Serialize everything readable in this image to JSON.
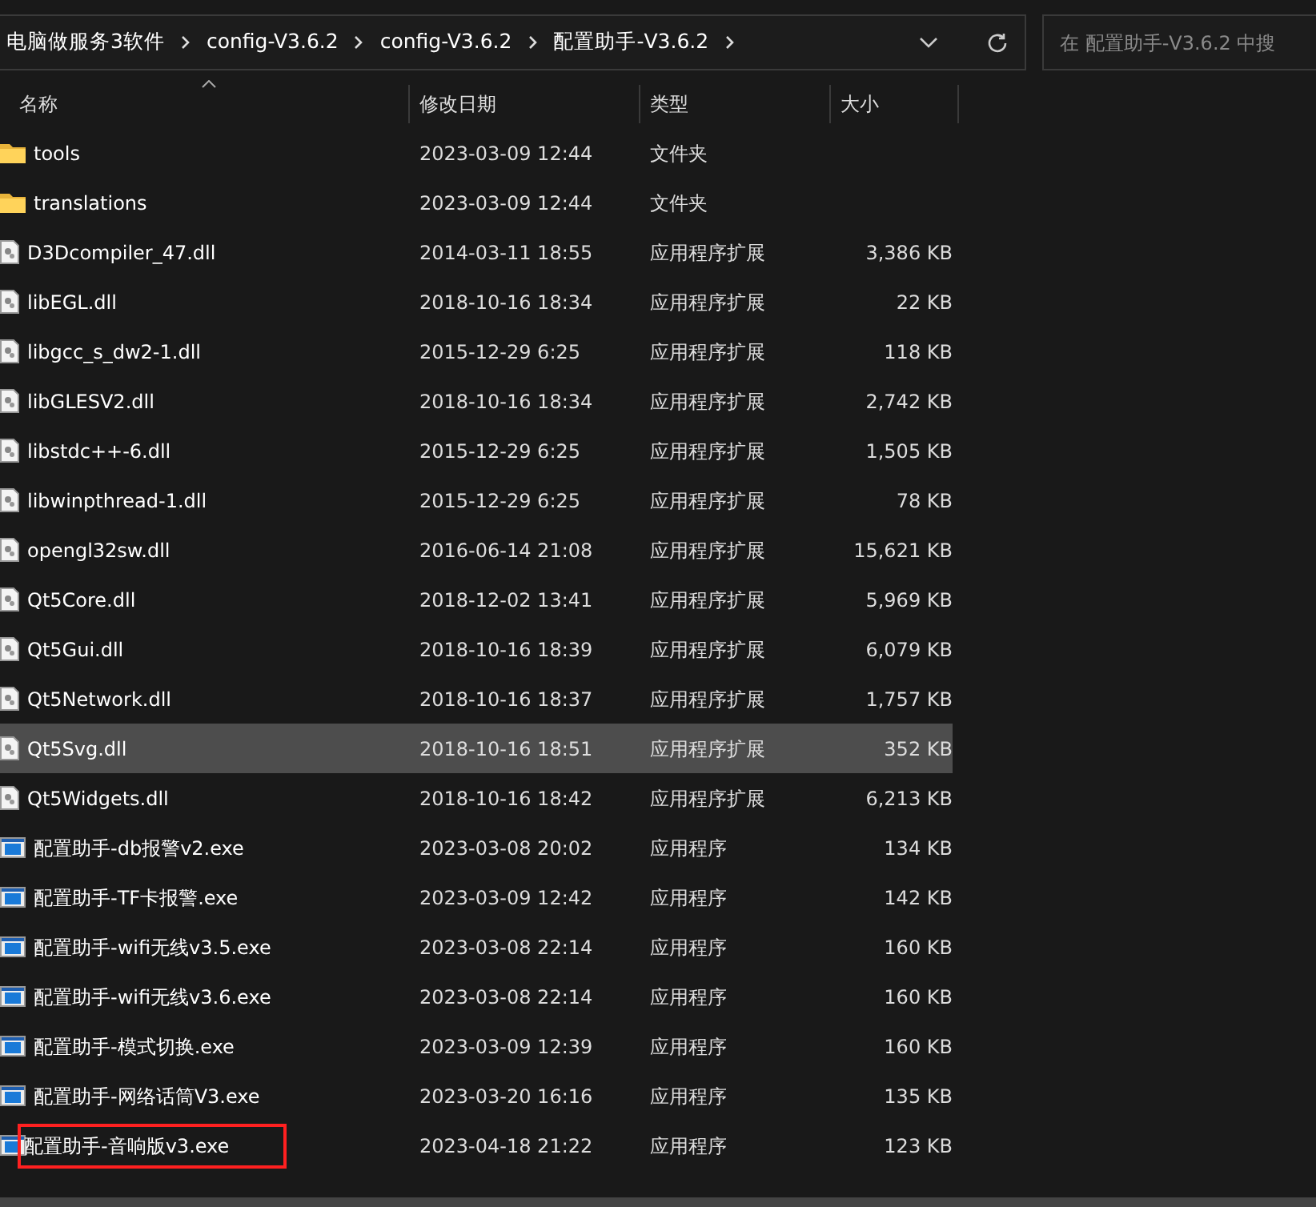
{
  "breadcrumb": [
    "电脑做服务3软件",
    "config-V3.6.2",
    "config-V3.6.2",
    "配置助手-V3.6.2"
  ],
  "search": {
    "placeholder": "在 配置助手-V3.6.2 中搜"
  },
  "columns": [
    "名称",
    "修改日期",
    "类型",
    "大小"
  ],
  "rows": [
    {
      "kind": "folder",
      "name": "tools",
      "date": "2023-03-09 12:44",
      "type": "文件夹",
      "selected": false
    },
    {
      "kind": "folder",
      "name": "translations",
      "date": "2023-03-09 12:44",
      "type": "文件夹",
      "selected": false
    },
    {
      "kind": "dll",
      "name": "D3Dcompiler_47.dll",
      "date": "2014-03-11 18:55",
      "type": "应用程序扩展",
      "size": "3,386 KB",
      "selected": false
    },
    {
      "kind": "dll",
      "name": "libEGL.dll",
      "date": "2018-10-16 18:34",
      "type": "应用程序扩展",
      "size": "22 KB",
      "selected": false
    },
    {
      "kind": "dll",
      "name": "libgcc_s_dw2-1.dll",
      "date": "2015-12-29 6:25",
      "type": "应用程序扩展",
      "size": "118 KB",
      "selected": false
    },
    {
      "kind": "dll",
      "name": "libGLESV2.dll",
      "date": "2018-10-16 18:34",
      "type": "应用程序扩展",
      "size": "2,742 KB",
      "selected": false
    },
    {
      "kind": "dll",
      "name": "libstdc++-6.dll",
      "date": "2015-12-29 6:25",
      "type": "应用程序扩展",
      "size": "1,505 KB",
      "selected": false
    },
    {
      "kind": "dll",
      "name": "libwinpthread-1.dll",
      "date": "2015-12-29 6:25",
      "type": "应用程序扩展",
      "size": "78 KB",
      "selected": false
    },
    {
      "kind": "dll",
      "name": "opengl32sw.dll",
      "date": "2016-06-14 21:08",
      "type": "应用程序扩展",
      "size": "15,621 KB",
      "selected": false
    },
    {
      "kind": "dll",
      "name": "Qt5Core.dll",
      "date": "2018-12-02 13:41",
      "type": "应用程序扩展",
      "size": "5,969 KB",
      "selected": false
    },
    {
      "kind": "dll",
      "name": "Qt5Gui.dll",
      "date": "2018-10-16 18:39",
      "type": "应用程序扩展",
      "size": "6,079 KB",
      "selected": false
    },
    {
      "kind": "dll",
      "name": "Qt5Network.dll",
      "date": "2018-10-16 18:37",
      "type": "应用程序扩展",
      "size": "1,757 KB",
      "selected": false
    },
    {
      "kind": "dll",
      "name": "Qt5Svg.dll",
      "date": "2018-10-16 18:51",
      "type": "应用程序扩展",
      "size": "352 KB",
      "selected": true
    },
    {
      "kind": "dll",
      "name": "Qt5Widgets.dll",
      "date": "2018-10-16 18:42",
      "type": "应用程序扩展",
      "size": "6,213 KB",
      "selected": false
    },
    {
      "kind": "exe",
      "name": "配置助手-db报警v2.exe",
      "date": "2023-03-08 20:02",
      "type": "应用程序",
      "size": "134 KB",
      "selected": false
    },
    {
      "kind": "exe",
      "name": "配置助手-TF卡报警.exe",
      "date": "2023-03-09 12:42",
      "type": "应用程序",
      "size": "142 KB",
      "selected": false
    },
    {
      "kind": "exe",
      "name": "配置助手-wifi无线v3.5.exe",
      "date": "2023-03-08 22:14",
      "type": "应用程序",
      "size": "160 KB",
      "selected": false
    },
    {
      "kind": "exe",
      "name": "配置助手-wifi无线v3.6.exe",
      "date": "2023-03-08 22:14",
      "type": "应用程序",
      "size": "160 KB",
      "selected": false
    },
    {
      "kind": "exe",
      "name": "配置助手-模式切换.exe",
      "date": "2023-03-09 12:39",
      "type": "应用程序",
      "size": "160 KB",
      "selected": false
    },
    {
      "kind": "exe",
      "name": "配置助手-网络话筒V3.exe",
      "date": "2023-03-20 16:16",
      "type": "应用程序",
      "size": "135 KB",
      "selected": false
    },
    {
      "kind": "exe",
      "name": "配置助手-音响版v3.exe",
      "date": "2023-04-18 21:22",
      "type": "应用程序",
      "size": "123 KB",
      "selected": false,
      "highlighted": true
    }
  ]
}
